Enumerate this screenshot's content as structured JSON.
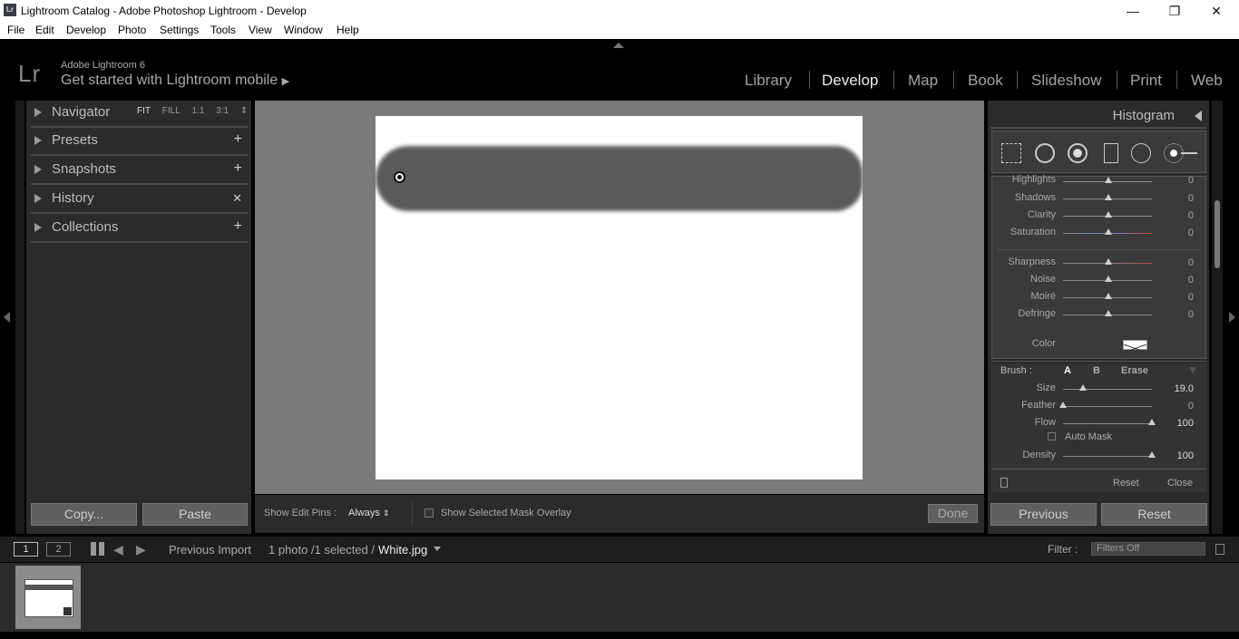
{
  "window": {
    "title": "Lightroom Catalog - Adobe Photoshop Lightroom - Develop",
    "app_badge": "Lr",
    "minimize": "—",
    "restore": "❐",
    "close": "✕"
  },
  "menu": [
    "File",
    "Edit",
    "Develop",
    "Photo",
    "Settings",
    "Tools",
    "View",
    "Window",
    "Help"
  ],
  "identity": {
    "logo": "Lr",
    "version": "Adobe Lightroom 6",
    "mobile": "Get started with Lightroom mobile",
    "mobile_arrow": "▶"
  },
  "modules": [
    "Library",
    "Develop",
    "Map",
    "Book",
    "Slideshow",
    "Print",
    "Web"
  ],
  "active_module": "Develop",
  "left_panel": {
    "navigator": {
      "label": "Navigator",
      "options": [
        "FIT",
        "FILL",
        "1:1",
        "3:1"
      ],
      "selected": "FIT",
      "stepper": "⇕"
    },
    "presets": {
      "label": "Presets",
      "action": "+"
    },
    "snapshots": {
      "label": "Snapshots",
      "action": "+"
    },
    "history": {
      "label": "History",
      "action": "✕"
    },
    "collections": {
      "label": "Collections",
      "action": "+"
    },
    "copy_button": "Copy...",
    "paste_button": "Paste"
  },
  "toolbar": {
    "show_pins_label": "Show Edit Pins :",
    "show_pins_value": "Always",
    "mask_overlay_label": "Show Selected Mask Overlay",
    "done_button": "Done"
  },
  "right_panel": {
    "header": "Histogram",
    "adjustments": [
      {
        "label": "Highlights",
        "value": "0"
      },
      {
        "label": "Shadows",
        "value": "0"
      },
      {
        "label": "Clarity",
        "value": "0"
      },
      {
        "label": "Saturation",
        "value": "0"
      },
      {
        "label": "Sharpness",
        "value": "0"
      },
      {
        "label": "Noise",
        "value": "0"
      },
      {
        "label": "Moiré",
        "value": "0"
      },
      {
        "label": "Defringe",
        "value": "0"
      }
    ],
    "color_label": "Color",
    "brush": {
      "label": "Brush :",
      "modes": [
        "A",
        "B",
        "Erase"
      ],
      "active_mode": "A"
    },
    "brush_sliders": [
      {
        "label": "Size",
        "value": "19.0",
        "level": 0.22
      },
      {
        "label": "Feather",
        "value": "0",
        "level": 0.0
      },
      {
        "label": "Flow",
        "value": "100",
        "level": 1.0
      }
    ],
    "auto_mask_label": "Auto Mask",
    "density": {
      "label": "Density",
      "value": "100",
      "level": 1.0
    },
    "reset_link": "Reset",
    "close_link": "Close",
    "previous_button": "Previous",
    "reset_button": "Reset"
  },
  "filmstrip": {
    "page1": "1",
    "page2": "2",
    "source": "Previous Import",
    "count": "1 photo /1 selected /",
    "filename": "White.jpg",
    "filter_label": "Filter :",
    "filter_value": "Filters Off"
  }
}
